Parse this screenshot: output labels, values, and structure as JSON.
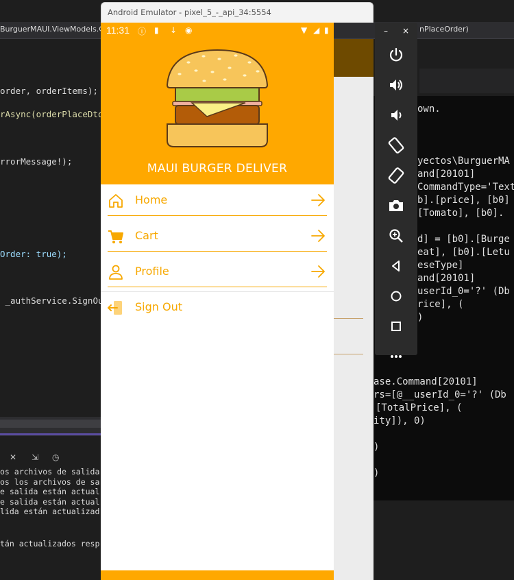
{
  "ide": {
    "tabs": [
      "BurguerMAUI.ViewModels.Car",
      "nPlaceOrder)"
    ],
    "code_lines": [
      {
        "text": "order, orderItems);"
      },
      {
        "text": "rAsync(orderPlaceDto"
      },
      {
        "text": "rrorMessage!);"
      },
      {
        "text": "Order: true);"
      },
      {
        "text": " _authService.SignOu"
      }
    ],
    "output_lines": [
      "os archivos de salida",
      "os los archivos de sa",
      "e salida están actual",
      "e salida están actual",
      "lida están actualizad",
      "tán actualizados resp"
    ],
    "terminal_lines": [
      "own.",
      "yectos\\BurguerMA",
      "and[20101]",
      "CommandType='Text",
      "b].[price], [b0]",
      "[Tomato], [b0].",
      "d] = [b0].[Burge",
      "eat], [b0].[Letu",
      "eseType]",
      "and[20101]",
      "userId_0='?' (Db",
      "rice], (",
      ")",
      "ase.Command[20101]",
      "rs=[@__userId_0='?' (Db",
      "[TotalPrice], (",
      "ity]), 0)",
      ")",
      ")"
    ]
  },
  "emulator": {
    "window_title": "Android Emulator - pixel_5_-_api_34:5554",
    "status_time": "11:31",
    "toolbar_minimize": "–",
    "toolbar_close": "×"
  },
  "app": {
    "title": "MAUI BURGER DELIVER",
    "menu": [
      {
        "label": "Home",
        "icon": "home-icon"
      },
      {
        "label": "Cart",
        "icon": "cart-icon"
      },
      {
        "label": "Profile",
        "icon": "profile-icon"
      },
      {
        "label": "Sign Out",
        "icon": "sign-out-icon"
      }
    ],
    "colors": {
      "primary": "#ffa800",
      "accent": "#f7a800"
    }
  }
}
